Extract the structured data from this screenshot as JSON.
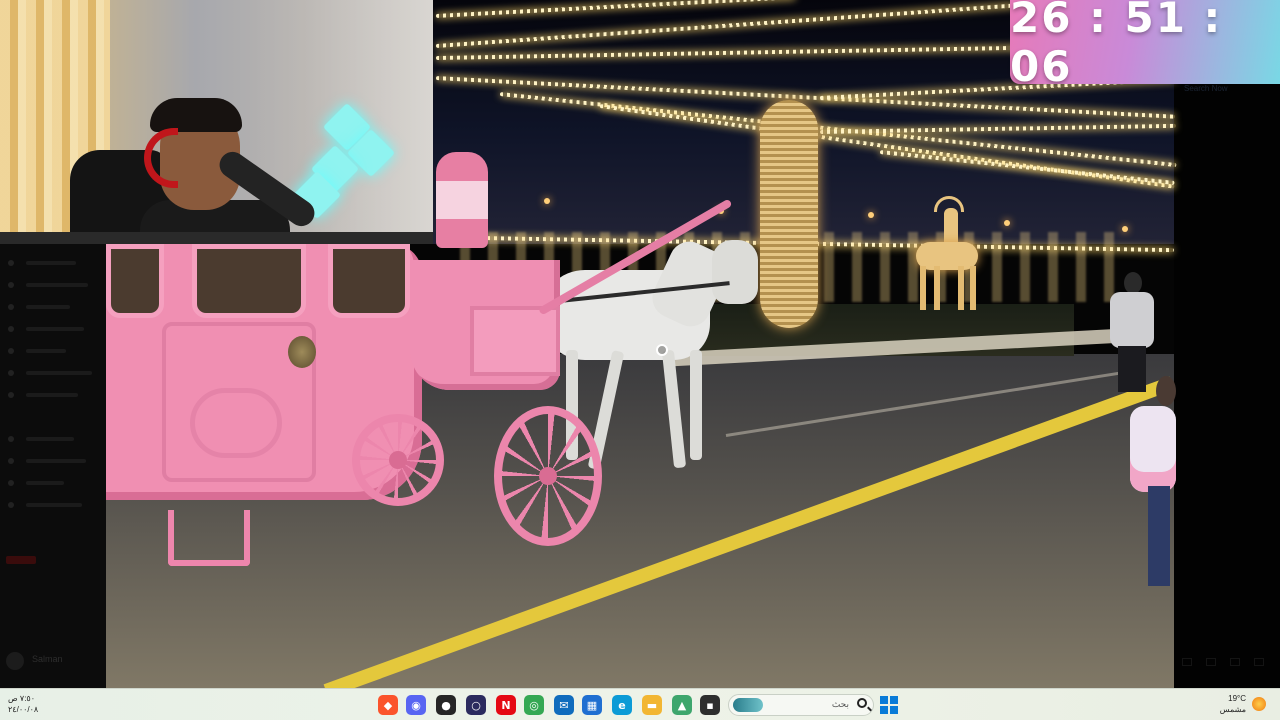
{
  "timer": {
    "display": "26 : 51 : 06"
  },
  "background_app": {
    "user_name": "Salman",
    "right_panel_label": "Search Now"
  },
  "taskbar": {
    "left_clock": {
      "time": "٧:٥٠ ص",
      "date": "٢٤/٠٠/٠٨"
    },
    "weather": {
      "temp": "19°C",
      "condition": "مشمس",
      "icon": "sun-icon"
    },
    "search_placeholder": "بحث",
    "apps": [
      {
        "name": "brave-icon",
        "color": "#fb542b",
        "glyph": "◆"
      },
      {
        "name": "discord-icon",
        "color": "#5865f2",
        "glyph": "◉"
      },
      {
        "name": "obs-icon",
        "color": "#262626",
        "glyph": "●"
      },
      {
        "name": "streaming-app-icon",
        "color": "#2b2b5e",
        "glyph": "○"
      },
      {
        "name": "netflix-icon",
        "color": "#e50914",
        "glyph": "N"
      },
      {
        "name": "chrome-icon",
        "color": "#34a853",
        "glyph": "◎"
      },
      {
        "name": "mail-icon",
        "color": "#0f6cbd",
        "glyph": "✉"
      },
      {
        "name": "store-icon",
        "color": "#1f6fd1",
        "glyph": "▦"
      },
      {
        "name": "edge-icon",
        "color": "#0c9bd6",
        "glyph": "e"
      },
      {
        "name": "file-explorer-icon",
        "color": "#f2b632",
        "glyph": "▬"
      },
      {
        "name": "photos-app-icon",
        "color": "#3ea66d",
        "glyph": "▲"
      },
      {
        "name": "terminal-icon",
        "color": "#2e2e2e",
        "glyph": "▪"
      }
    ],
    "colors": {
      "windows_blue": "#0a7bd8"
    }
  },
  "colors": {
    "timer_gradient": [
      "#e67ab9",
      "#c98ad8",
      "#79d8e5"
    ],
    "carriage_pink": "#f08fb2"
  }
}
